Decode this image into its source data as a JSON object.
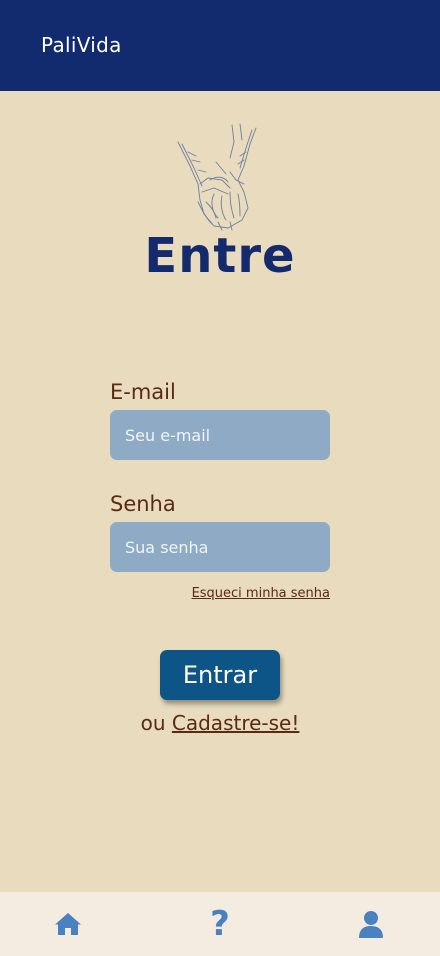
{
  "header": {
    "app_title": "PaliVida"
  },
  "login": {
    "title": "Entre",
    "email_label": "E-mail",
    "email_placeholder": "Seu e-mail",
    "email_value": "",
    "password_label": "Senha",
    "password_placeholder": "Sua senha",
    "password_value": "",
    "forgot_password": "Esqueci minha senha",
    "submit_label": "Entrar",
    "signup_prefix": "ou ",
    "signup_link": "Cadastre-se!"
  },
  "logo": {
    "icon": "holding-hands-icon"
  },
  "bottom_nav": {
    "items": [
      {
        "icon": "home-icon"
      },
      {
        "icon": "help-icon",
        "glyph": "?"
      },
      {
        "icon": "user-icon"
      }
    ]
  },
  "colors": {
    "background": "#e8dbbe",
    "header": "#122a6e",
    "title": "#142a6c",
    "label": "#5a2a14",
    "input": "#8eaac5",
    "button": "#0d5586",
    "nav_background": "#f4ece1",
    "nav_icon": "#4a82c1"
  }
}
